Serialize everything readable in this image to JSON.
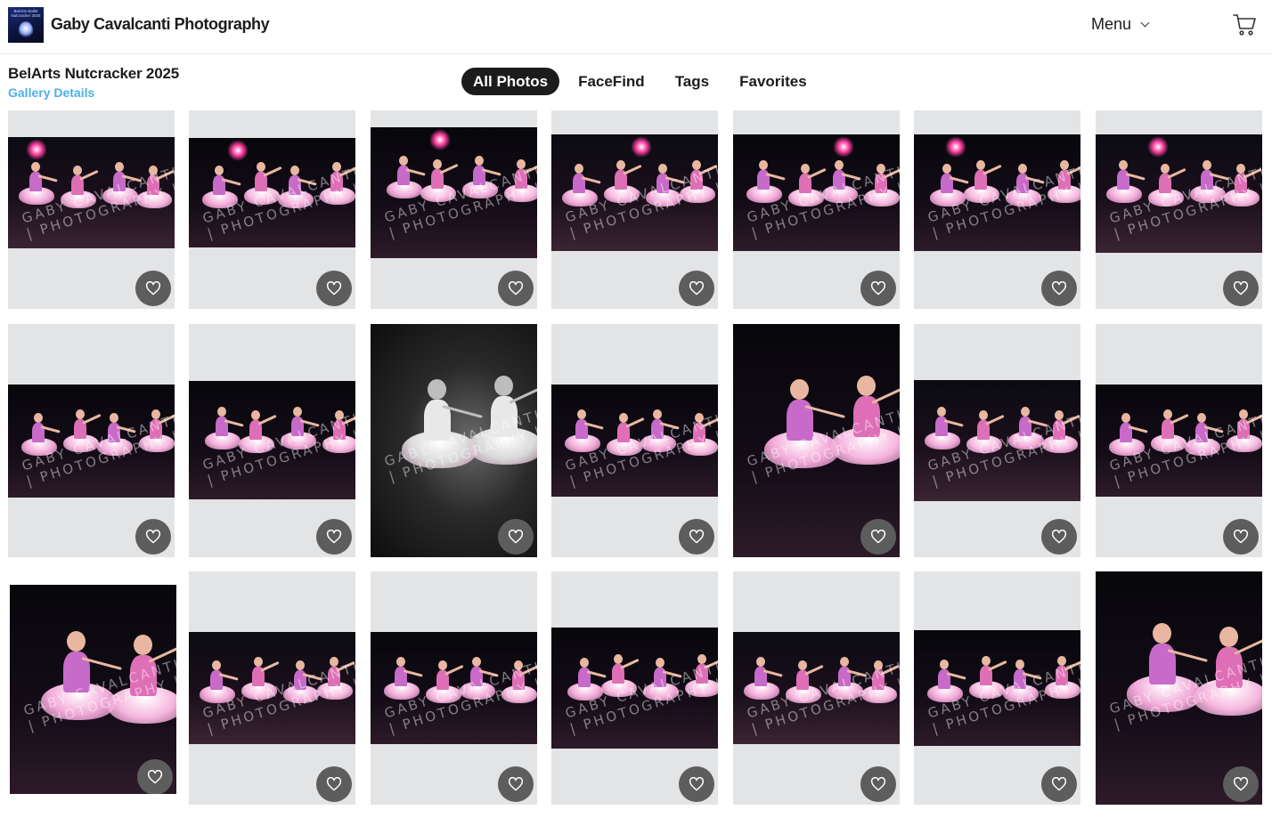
{
  "header": {
    "logo_text": "BelArts Ballet Nutcracker 2025",
    "site_title": "Gaby Cavalcanti Photography",
    "menu_label": "Menu",
    "icons": {
      "menu": "chevron-down-icon",
      "cart": "cart-icon",
      "favorite": "heart-icon"
    }
  },
  "gallery": {
    "title": "BelArts Nutcracker 2025",
    "details_link": "Gallery Details"
  },
  "tabs": [
    {
      "label": "All Photos",
      "active": true
    },
    {
      "label": "FaceFind",
      "active": false
    },
    {
      "label": "Tags",
      "active": false
    },
    {
      "label": "Favorites",
      "active": false
    }
  ],
  "watermark": {
    "line1": "GABY CAVALCANTI",
    "line2": "| PHOTOGRAPHY |"
  },
  "colors": {
    "accent_link": "#4faeea",
    "active_tab": "#1c1c1c",
    "card_bg": "#e3e4e6",
    "favorite_button": "#5d5d5d",
    "tutu_pink": "#f2a9d8",
    "stage_light": "#ff3fa0"
  },
  "photos": [
    {
      "id": 1,
      "scene": "color",
      "favorited": false
    },
    {
      "id": 2,
      "scene": "color",
      "favorited": false
    },
    {
      "id": 3,
      "scene": "color",
      "favorited": false
    },
    {
      "id": 4,
      "scene": "color",
      "favorited": false
    },
    {
      "id": 5,
      "scene": "color",
      "favorited": false
    },
    {
      "id": 6,
      "scene": "color",
      "favorited": false
    },
    {
      "id": 7,
      "scene": "color",
      "favorited": false
    },
    {
      "id": 8,
      "scene": "color",
      "favorited": false
    },
    {
      "id": 9,
      "scene": "color",
      "favorited": false
    },
    {
      "id": 10,
      "scene": "black-and-white",
      "favorited": false
    },
    {
      "id": 11,
      "scene": "color",
      "favorited": false
    },
    {
      "id": 12,
      "scene": "color",
      "favorited": false
    },
    {
      "id": 13,
      "scene": "color",
      "favorited": false
    },
    {
      "id": 14,
      "scene": "color",
      "favorited": false
    },
    {
      "id": 15,
      "scene": "color",
      "favorited": false
    },
    {
      "id": 16,
      "scene": "color",
      "favorited": false
    },
    {
      "id": 17,
      "scene": "color",
      "favorited": false
    },
    {
      "id": 18,
      "scene": "color",
      "favorited": false
    },
    {
      "id": 19,
      "scene": "color",
      "favorited": false
    },
    {
      "id": 20,
      "scene": "color",
      "favorited": false
    },
    {
      "id": 21,
      "scene": "color",
      "favorited": false
    }
  ]
}
